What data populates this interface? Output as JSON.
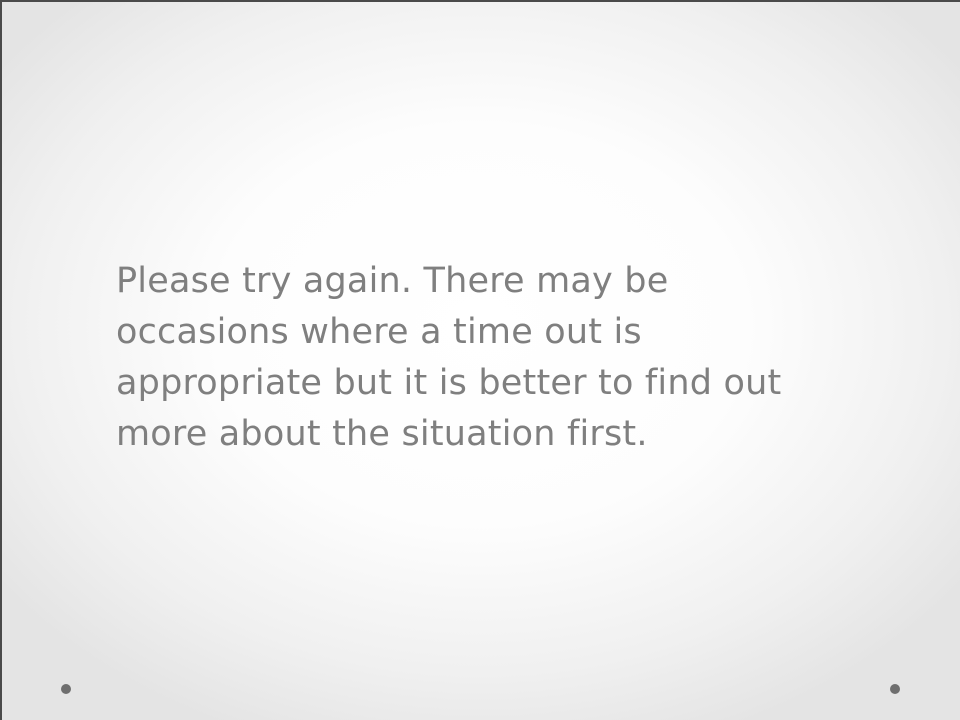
{
  "slide": {
    "body_text": "Please try again. There may be occasions where a time out is appropriate but it is better to find out more about the situation first."
  },
  "colors": {
    "text": "#7f7f7f",
    "frame": "#4a4a4a",
    "dot": "#6e6e6e"
  },
  "icons": {
    "left_decoration": "dot-icon",
    "right_decoration": "dot-icon"
  }
}
